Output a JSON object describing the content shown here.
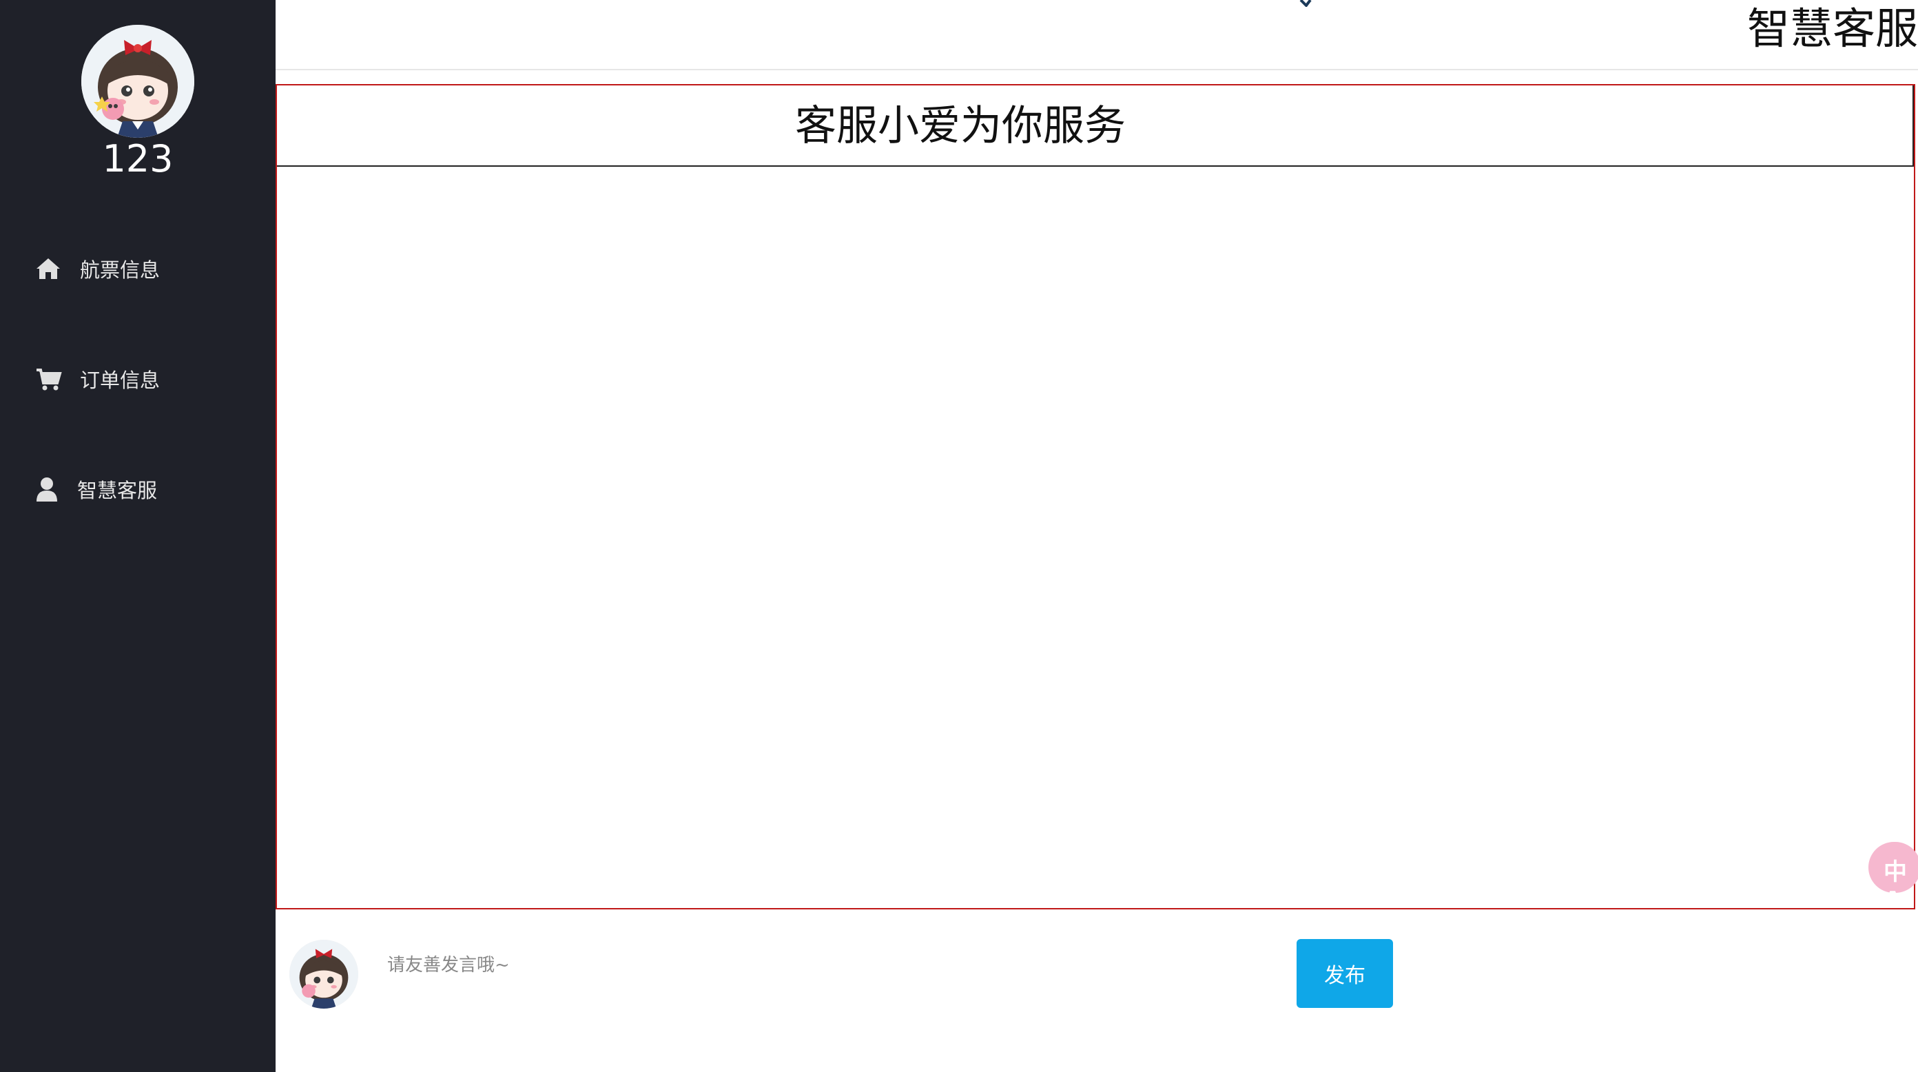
{
  "sidebar": {
    "username": "123",
    "nav": [
      {
        "label": "航票信息",
        "icon": "home-icon"
      },
      {
        "label": "订单信息",
        "icon": "cart-icon"
      },
      {
        "label": "智慧客服",
        "icon": "user-icon"
      }
    ]
  },
  "header": {
    "title": "智慧客服"
  },
  "chat": {
    "title": "客服小爱为你服务"
  },
  "composer": {
    "placeholder": "请友善发言哦~",
    "submit_label": "发布"
  },
  "floating": {
    "translate_label": "中A"
  },
  "colors": {
    "sidebar_bg": "#1f2129",
    "frame_border": "#c01818",
    "publish_button": "#0fa7e8",
    "translate_button": "#f6b8cf"
  }
}
